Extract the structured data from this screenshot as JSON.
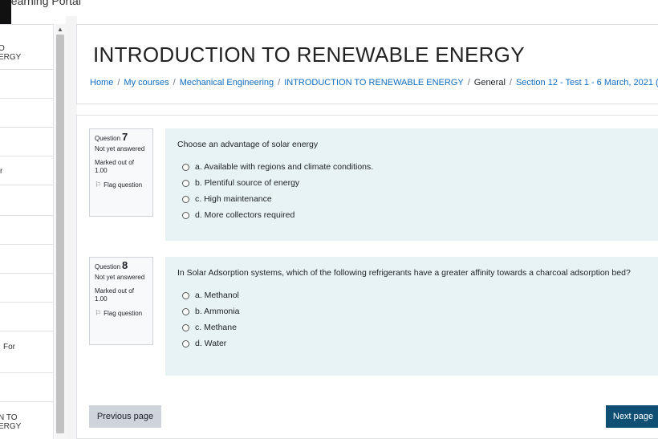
{
  "site": {
    "name": "Learning Portal"
  },
  "drawer": {
    "items": [
      {
        "label": "O\nERGY"
      },
      {
        "label": ""
      },
      {
        "label": ""
      },
      {
        "label": ""
      },
      {
        "label": "r"
      },
      {
        "label": ""
      },
      {
        "label": ""
      },
      {
        "label": ""
      },
      {
        "label": ""
      },
      {
        "label": ""
      },
      {
        "label": "For"
      },
      {
        "label": ""
      },
      {
        "label": "N TO\nERGY"
      }
    ]
  },
  "header": {
    "title": "INTRODUCTION TO RENEWABLE ENERGY",
    "breadcrumb": [
      {
        "label": "Home"
      },
      {
        "label": "My courses"
      },
      {
        "label": "Mechanical Engineering"
      },
      {
        "label": "INTRODUCTION TO RENEWABLE ENERGY"
      },
      {
        "label": "General"
      },
      {
        "label": "Section 12 - Test 1 - 6 March, 2021 ("
      }
    ]
  },
  "questions": [
    {
      "label": "Question",
      "number": "7",
      "state": "Not yet answered",
      "grade": "Marked out of 1.00",
      "flag": "Flag question",
      "text": "Choose an advantage of solar energy",
      "answers": [
        "a. Available with regions and climate conditions.",
        "b. Plentiful source of energy",
        "c. High maintenance",
        "d. More collectors required"
      ]
    },
    {
      "label": "Question",
      "number": "8",
      "state": "Not yet answered",
      "grade": "Marked out of 1.00",
      "flag": "Flag question",
      "text": "In Solar Adsorption systems, which of the following refrigerants have a greater affinity towards a charcoal adsorption bed?",
      "answers": [
        "a. Methanol",
        "b. Ammonia",
        "c. Methane",
        "d. Water"
      ]
    }
  ],
  "nav": {
    "prev": "Previous page",
    "next": "Next page"
  },
  "icons": {
    "flag": "flag-icon",
    "scroll_up": "scroll-up-arrow-icon"
  },
  "colors": {
    "link": "#0f6cbf",
    "next_button": "#0f4f74",
    "question_bg": "#e7f3f5"
  }
}
